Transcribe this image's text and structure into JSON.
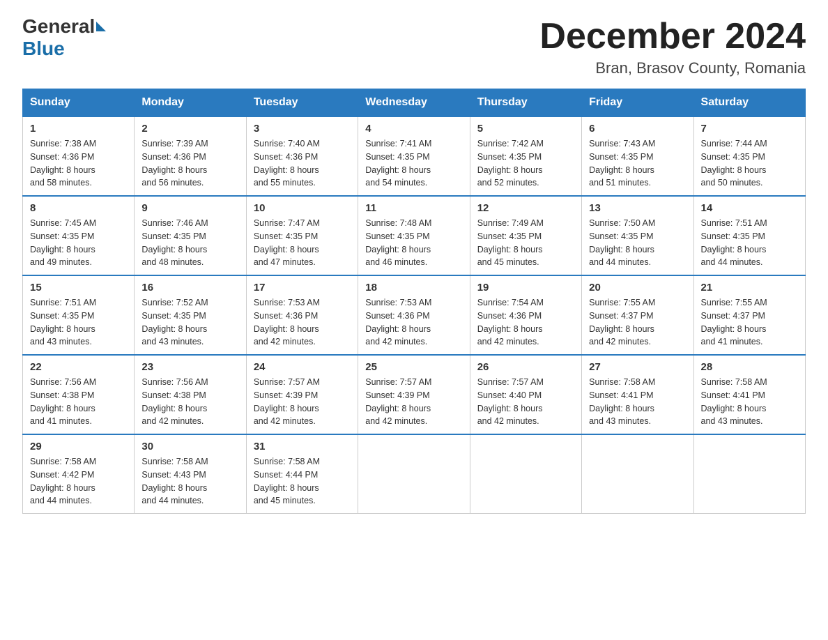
{
  "header": {
    "logo_general": "General",
    "logo_blue": "Blue",
    "month_title": "December 2024",
    "location": "Bran, Brasov County, Romania"
  },
  "days_of_week": [
    "Sunday",
    "Monday",
    "Tuesday",
    "Wednesday",
    "Thursday",
    "Friday",
    "Saturday"
  ],
  "weeks": [
    [
      {
        "num": "1",
        "sunrise": "7:38 AM",
        "sunset": "4:36 PM",
        "daylight": "8 hours and 58 minutes."
      },
      {
        "num": "2",
        "sunrise": "7:39 AM",
        "sunset": "4:36 PM",
        "daylight": "8 hours and 56 minutes."
      },
      {
        "num": "3",
        "sunrise": "7:40 AM",
        "sunset": "4:36 PM",
        "daylight": "8 hours and 55 minutes."
      },
      {
        "num": "4",
        "sunrise": "7:41 AM",
        "sunset": "4:35 PM",
        "daylight": "8 hours and 54 minutes."
      },
      {
        "num": "5",
        "sunrise": "7:42 AM",
        "sunset": "4:35 PM",
        "daylight": "8 hours and 52 minutes."
      },
      {
        "num": "6",
        "sunrise": "7:43 AM",
        "sunset": "4:35 PM",
        "daylight": "8 hours and 51 minutes."
      },
      {
        "num": "7",
        "sunrise": "7:44 AM",
        "sunset": "4:35 PM",
        "daylight": "8 hours and 50 minutes."
      }
    ],
    [
      {
        "num": "8",
        "sunrise": "7:45 AM",
        "sunset": "4:35 PM",
        "daylight": "8 hours and 49 minutes."
      },
      {
        "num": "9",
        "sunrise": "7:46 AM",
        "sunset": "4:35 PM",
        "daylight": "8 hours and 48 minutes."
      },
      {
        "num": "10",
        "sunrise": "7:47 AM",
        "sunset": "4:35 PM",
        "daylight": "8 hours and 47 minutes."
      },
      {
        "num": "11",
        "sunrise": "7:48 AM",
        "sunset": "4:35 PM",
        "daylight": "8 hours and 46 minutes."
      },
      {
        "num": "12",
        "sunrise": "7:49 AM",
        "sunset": "4:35 PM",
        "daylight": "8 hours and 45 minutes."
      },
      {
        "num": "13",
        "sunrise": "7:50 AM",
        "sunset": "4:35 PM",
        "daylight": "8 hours and 44 minutes."
      },
      {
        "num": "14",
        "sunrise": "7:51 AM",
        "sunset": "4:35 PM",
        "daylight": "8 hours and 44 minutes."
      }
    ],
    [
      {
        "num": "15",
        "sunrise": "7:51 AM",
        "sunset": "4:35 PM",
        "daylight": "8 hours and 43 minutes."
      },
      {
        "num": "16",
        "sunrise": "7:52 AM",
        "sunset": "4:35 PM",
        "daylight": "8 hours and 43 minutes."
      },
      {
        "num": "17",
        "sunrise": "7:53 AM",
        "sunset": "4:36 PM",
        "daylight": "8 hours and 42 minutes."
      },
      {
        "num": "18",
        "sunrise": "7:53 AM",
        "sunset": "4:36 PM",
        "daylight": "8 hours and 42 minutes."
      },
      {
        "num": "19",
        "sunrise": "7:54 AM",
        "sunset": "4:36 PM",
        "daylight": "8 hours and 42 minutes."
      },
      {
        "num": "20",
        "sunrise": "7:55 AM",
        "sunset": "4:37 PM",
        "daylight": "8 hours and 42 minutes."
      },
      {
        "num": "21",
        "sunrise": "7:55 AM",
        "sunset": "4:37 PM",
        "daylight": "8 hours and 41 minutes."
      }
    ],
    [
      {
        "num": "22",
        "sunrise": "7:56 AM",
        "sunset": "4:38 PM",
        "daylight": "8 hours and 41 minutes."
      },
      {
        "num": "23",
        "sunrise": "7:56 AM",
        "sunset": "4:38 PM",
        "daylight": "8 hours and 42 minutes."
      },
      {
        "num": "24",
        "sunrise": "7:57 AM",
        "sunset": "4:39 PM",
        "daylight": "8 hours and 42 minutes."
      },
      {
        "num": "25",
        "sunrise": "7:57 AM",
        "sunset": "4:39 PM",
        "daylight": "8 hours and 42 minutes."
      },
      {
        "num": "26",
        "sunrise": "7:57 AM",
        "sunset": "4:40 PM",
        "daylight": "8 hours and 42 minutes."
      },
      {
        "num": "27",
        "sunrise": "7:58 AM",
        "sunset": "4:41 PM",
        "daylight": "8 hours and 43 minutes."
      },
      {
        "num": "28",
        "sunrise": "7:58 AM",
        "sunset": "4:41 PM",
        "daylight": "8 hours and 43 minutes."
      }
    ],
    [
      {
        "num": "29",
        "sunrise": "7:58 AM",
        "sunset": "4:42 PM",
        "daylight": "8 hours and 44 minutes."
      },
      {
        "num": "30",
        "sunrise": "7:58 AM",
        "sunset": "4:43 PM",
        "daylight": "8 hours and 44 minutes."
      },
      {
        "num": "31",
        "sunrise": "7:58 AM",
        "sunset": "4:44 PM",
        "daylight": "8 hours and 45 minutes."
      },
      null,
      null,
      null,
      null
    ]
  ],
  "labels": {
    "sunrise": "Sunrise:",
    "sunset": "Sunset:",
    "daylight": "Daylight:"
  }
}
